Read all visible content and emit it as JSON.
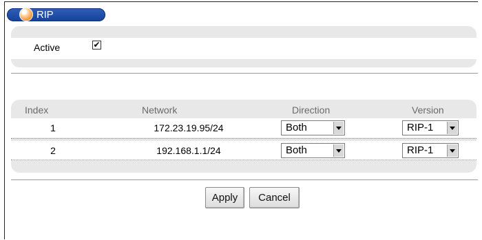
{
  "title": "RIP",
  "active": {
    "label": "Active",
    "checked": true,
    "check_mark": "✔"
  },
  "table": {
    "headers": [
      "Index",
      "Network",
      "Direction",
      "Version"
    ],
    "rows": [
      {
        "index": "1",
        "network": "172.23.19.95/24",
        "direction": "Both",
        "version": "RIP-1"
      },
      {
        "index": "2",
        "network": "192.168.1.1/24",
        "direction": "Both",
        "version": "RIP-1"
      }
    ]
  },
  "buttons": {
    "apply": "Apply",
    "cancel": "Cancel"
  },
  "colors": {
    "title_bg": "#1f50aa",
    "panel_bg": "#e8e8e8",
    "header_text": "#6a6a6a"
  },
  "icons": {
    "title": "orange-dot-icon",
    "select_arrow": "chevron-down-icon",
    "checkbox": "checkbox-icon"
  }
}
